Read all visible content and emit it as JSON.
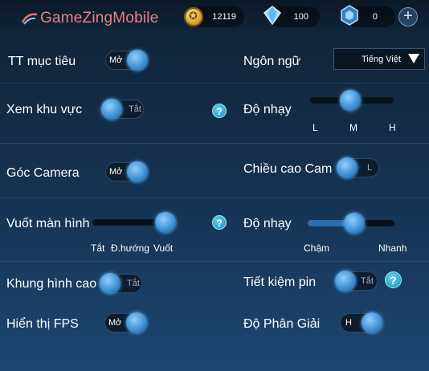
{
  "header": {
    "logo_text": "GameZingMobile",
    "gold": "12119",
    "diamonds": "100",
    "vouchers": "0",
    "add_label": "+"
  },
  "left": {
    "target_info": {
      "label": "TT mục tiêu",
      "state": "Mở"
    },
    "view_area": {
      "label": "Xem khu vực",
      "state": "Tắt"
    },
    "camera_angle": {
      "label": "Góc Camera",
      "state": "Mở"
    },
    "swipe_screen": {
      "label": "Vuốt màn hình",
      "options": [
        "Tắt",
        "Đ.hướng",
        "Vuốt"
      ],
      "selected": "Vuốt"
    },
    "high_framerate": {
      "label": "Khung hình cao",
      "state": "Tắt"
    },
    "show_fps": {
      "label": "Hiển thị FPS",
      "state": "Mở"
    }
  },
  "right": {
    "language": {
      "label": "Ngôn ngữ",
      "value": "Tiếng Việt"
    },
    "sensitivity1": {
      "label": "Độ nhạy",
      "ticks": [
        "L",
        "M",
        "H"
      ],
      "selected": "M"
    },
    "camera_height": {
      "label": "Chiều cao Cam",
      "state": "L"
    },
    "sensitivity2": {
      "label": "Độ nhạy",
      "min_label": "Chậm",
      "max_label": "Nhanh",
      "level": 0.5
    },
    "battery_saver": {
      "label": "Tiết kiệm pin",
      "state": "Tắt"
    },
    "resolution": {
      "label": "Độ Phân Giải",
      "state": "H"
    }
  },
  "help_symbol": "?"
}
